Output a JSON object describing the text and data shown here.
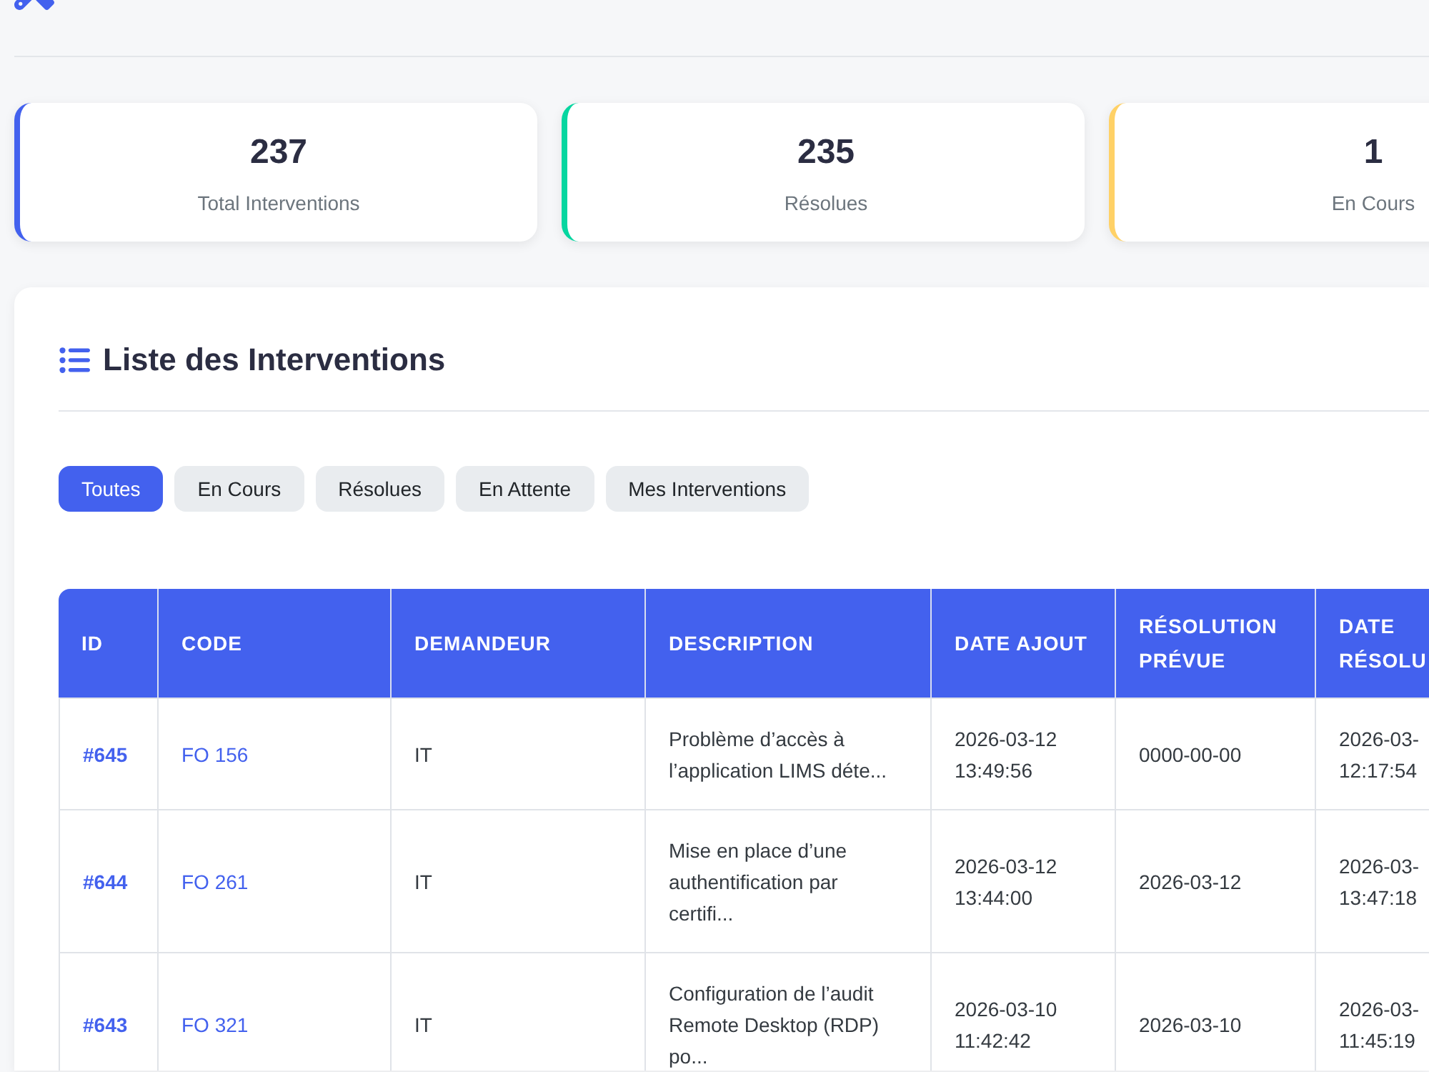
{
  "stats": [
    {
      "value": "237",
      "label": "Total Interventions",
      "color": "#4361ee"
    },
    {
      "value": "235",
      "label": "Résolues",
      "color": "#06d6a0"
    },
    {
      "value": "1",
      "label": "En Cours",
      "color": "#ffd166"
    }
  ],
  "interventions": {
    "title": "Liste des Interventions",
    "filters": [
      {
        "label": "Toutes",
        "selected": true
      },
      {
        "label": "En Cours",
        "selected": false
      },
      {
        "label": "Résolues",
        "selected": false
      },
      {
        "label": "En Attente",
        "selected": false
      },
      {
        "label": "Mes Interventions",
        "selected": false
      }
    ],
    "table": {
      "columns": [
        "ID",
        "CODE",
        "DEMANDEUR",
        "DESCRIPTION",
        "DATE AJOUT",
        "RÉSOLUTION PRÉVUE",
        "DATE RÉSOLU"
      ],
      "rows": [
        {
          "id": "#645",
          "code": "FO 156",
          "requester": "IT",
          "description": "Problème d’accès à l’application LIMS déte...",
          "date_added": "2026-03-12 13:49:56",
          "planned_resolution": "0000-00-00",
          "resolution_date": "2026-03- 12:17:54"
        },
        {
          "id": "#644",
          "code": "FO 261",
          "requester": "IT",
          "description": "Mise en place d’une authentification par certifi...",
          "date_added": "2026-03-12 13:44:00",
          "planned_resolution": "2026-03-12",
          "resolution_date": "2026-03- 13:47:18"
        },
        {
          "id": "#643",
          "code": "FO 321",
          "requester": "IT",
          "description": "Configuration de l’audit Remote Desktop (RDP) po...",
          "date_added": "2026-03-10 11:42:42",
          "planned_resolution": "2026-03-10",
          "resolution_date": "2026-03- 11:45:19"
        }
      ]
    }
  }
}
